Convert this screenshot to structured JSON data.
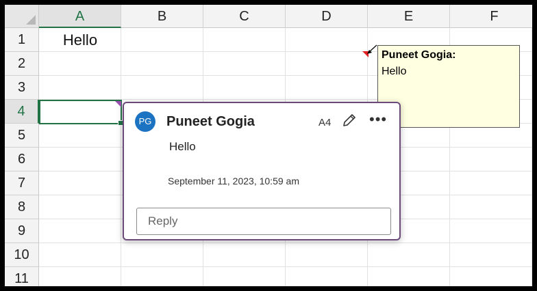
{
  "columns": [
    "A",
    "B",
    "C",
    "D",
    "E",
    "F"
  ],
  "rows": [
    "1",
    "2",
    "3",
    "4",
    "5",
    "6",
    "7",
    "8",
    "9",
    "10",
    "11"
  ],
  "selected": {
    "column": "A",
    "row": "4"
  },
  "cells": {
    "A1": "Hello"
  },
  "note": {
    "author": "Puneet Gogia:",
    "text": "Hello"
  },
  "comment": {
    "avatar_initials": "PG",
    "author": "Puneet Gogia",
    "cell_ref": "A4",
    "text": "Hello",
    "timestamp": "September 11, 2023, 10:59 am",
    "reply_placeholder": "Reply",
    "edit_icon": "pencil-icon",
    "more_icon": "more-options-icon"
  },
  "colors": {
    "accent_green": "#217346",
    "thread_marker": "#9b4fb0",
    "note_marker": "#e02020",
    "note_background": "#ffffe1",
    "avatar": "#1b73c2",
    "card_border": "#6b4a7a"
  }
}
